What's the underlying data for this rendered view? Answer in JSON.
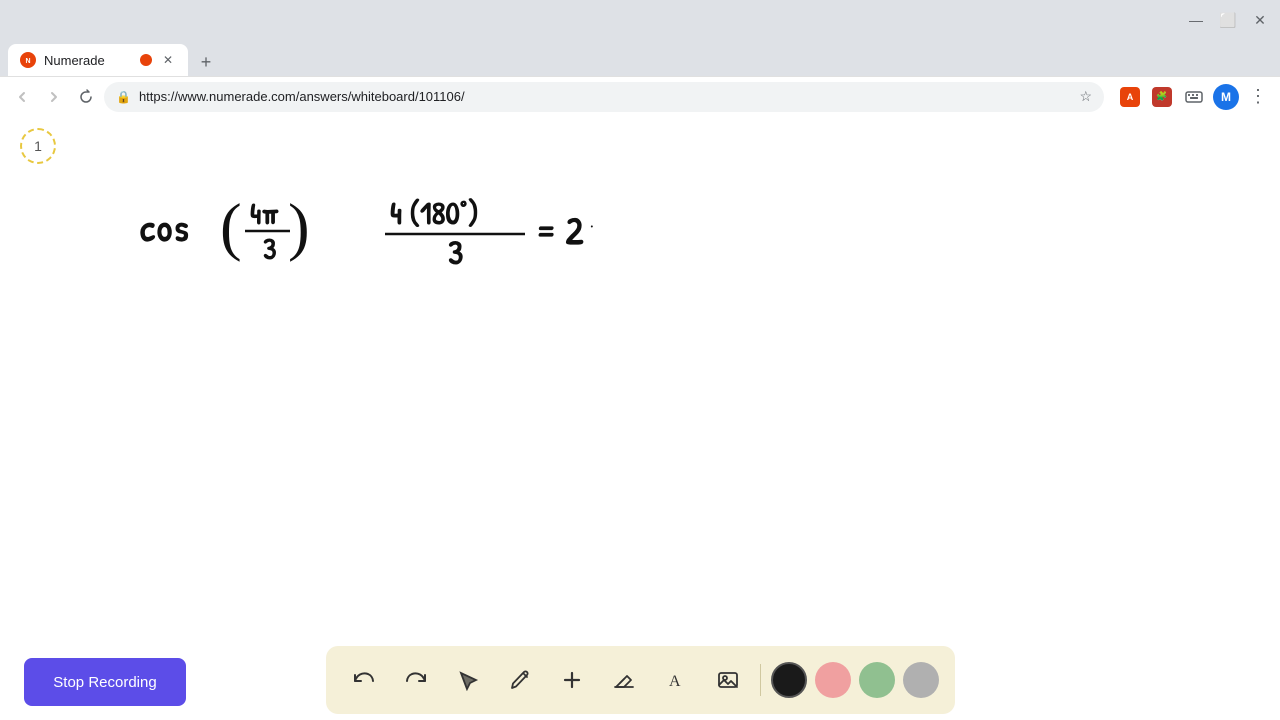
{
  "browser": {
    "tab_title": "Numerade",
    "tab_favicon": "N",
    "url": "https://www.numerade.com/answers/whiteboard/101106/",
    "new_tab_label": "+",
    "nav_back_label": "←",
    "nav_forward_label": "→",
    "nav_reload_label": "↻",
    "profile_letter": "M",
    "more_options_label": "⋮"
  },
  "page": {
    "page_number": "1",
    "background_color": "#ffffff"
  },
  "toolbar": {
    "tools": [
      {
        "id": "undo",
        "icon": "↩",
        "label": "Undo"
      },
      {
        "id": "redo",
        "icon": "↪",
        "label": "Redo"
      },
      {
        "id": "select",
        "icon": "▲",
        "label": "Select"
      },
      {
        "id": "pen",
        "icon": "✏",
        "label": "Pen"
      },
      {
        "id": "add",
        "icon": "+",
        "label": "Add"
      },
      {
        "id": "eraser",
        "icon": "◻",
        "label": "Eraser"
      },
      {
        "id": "text",
        "icon": "A",
        "label": "Text"
      },
      {
        "id": "image",
        "icon": "🖼",
        "label": "Image"
      }
    ],
    "colors": [
      {
        "id": "black",
        "hex": "#1a1a1a",
        "active": true
      },
      {
        "id": "pink",
        "hex": "#f0a0a0"
      },
      {
        "id": "green",
        "hex": "#90c090"
      },
      {
        "id": "gray",
        "hex": "#b0b0b0"
      }
    ]
  },
  "stop_recording": {
    "label": "Stop Recording",
    "bg_color": "#5c4de8",
    "text_color": "#ffffff"
  },
  "math": {
    "expression": "cos(4π/3) and 4(180°)/3 = 2"
  }
}
